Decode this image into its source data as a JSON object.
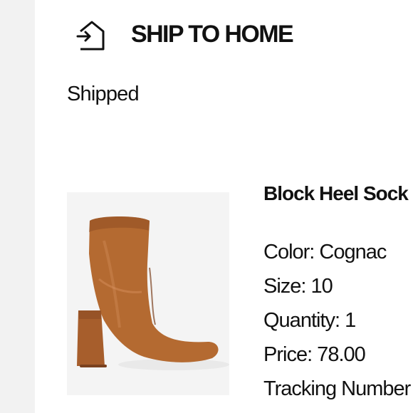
{
  "shipment": {
    "method_label": "SHIP TO HOME",
    "method_icon": "ship-to-home-icon",
    "status": "Shipped"
  },
  "product": {
    "name": "Block Heel Sock Bootie",
    "image_icon": "cognac-block-heel-bootie",
    "color_label": "Color: Cognac",
    "size_label": "Size: 10",
    "quantity_label": "Quantity: 1",
    "price_label": "Price: 78.00",
    "tracking_label": "Tracking Number"
  },
  "colors": {
    "text": "#111111",
    "gutter": "#f2f2f2",
    "image_background": "#f4f4f4",
    "boot": "#b2642c"
  }
}
